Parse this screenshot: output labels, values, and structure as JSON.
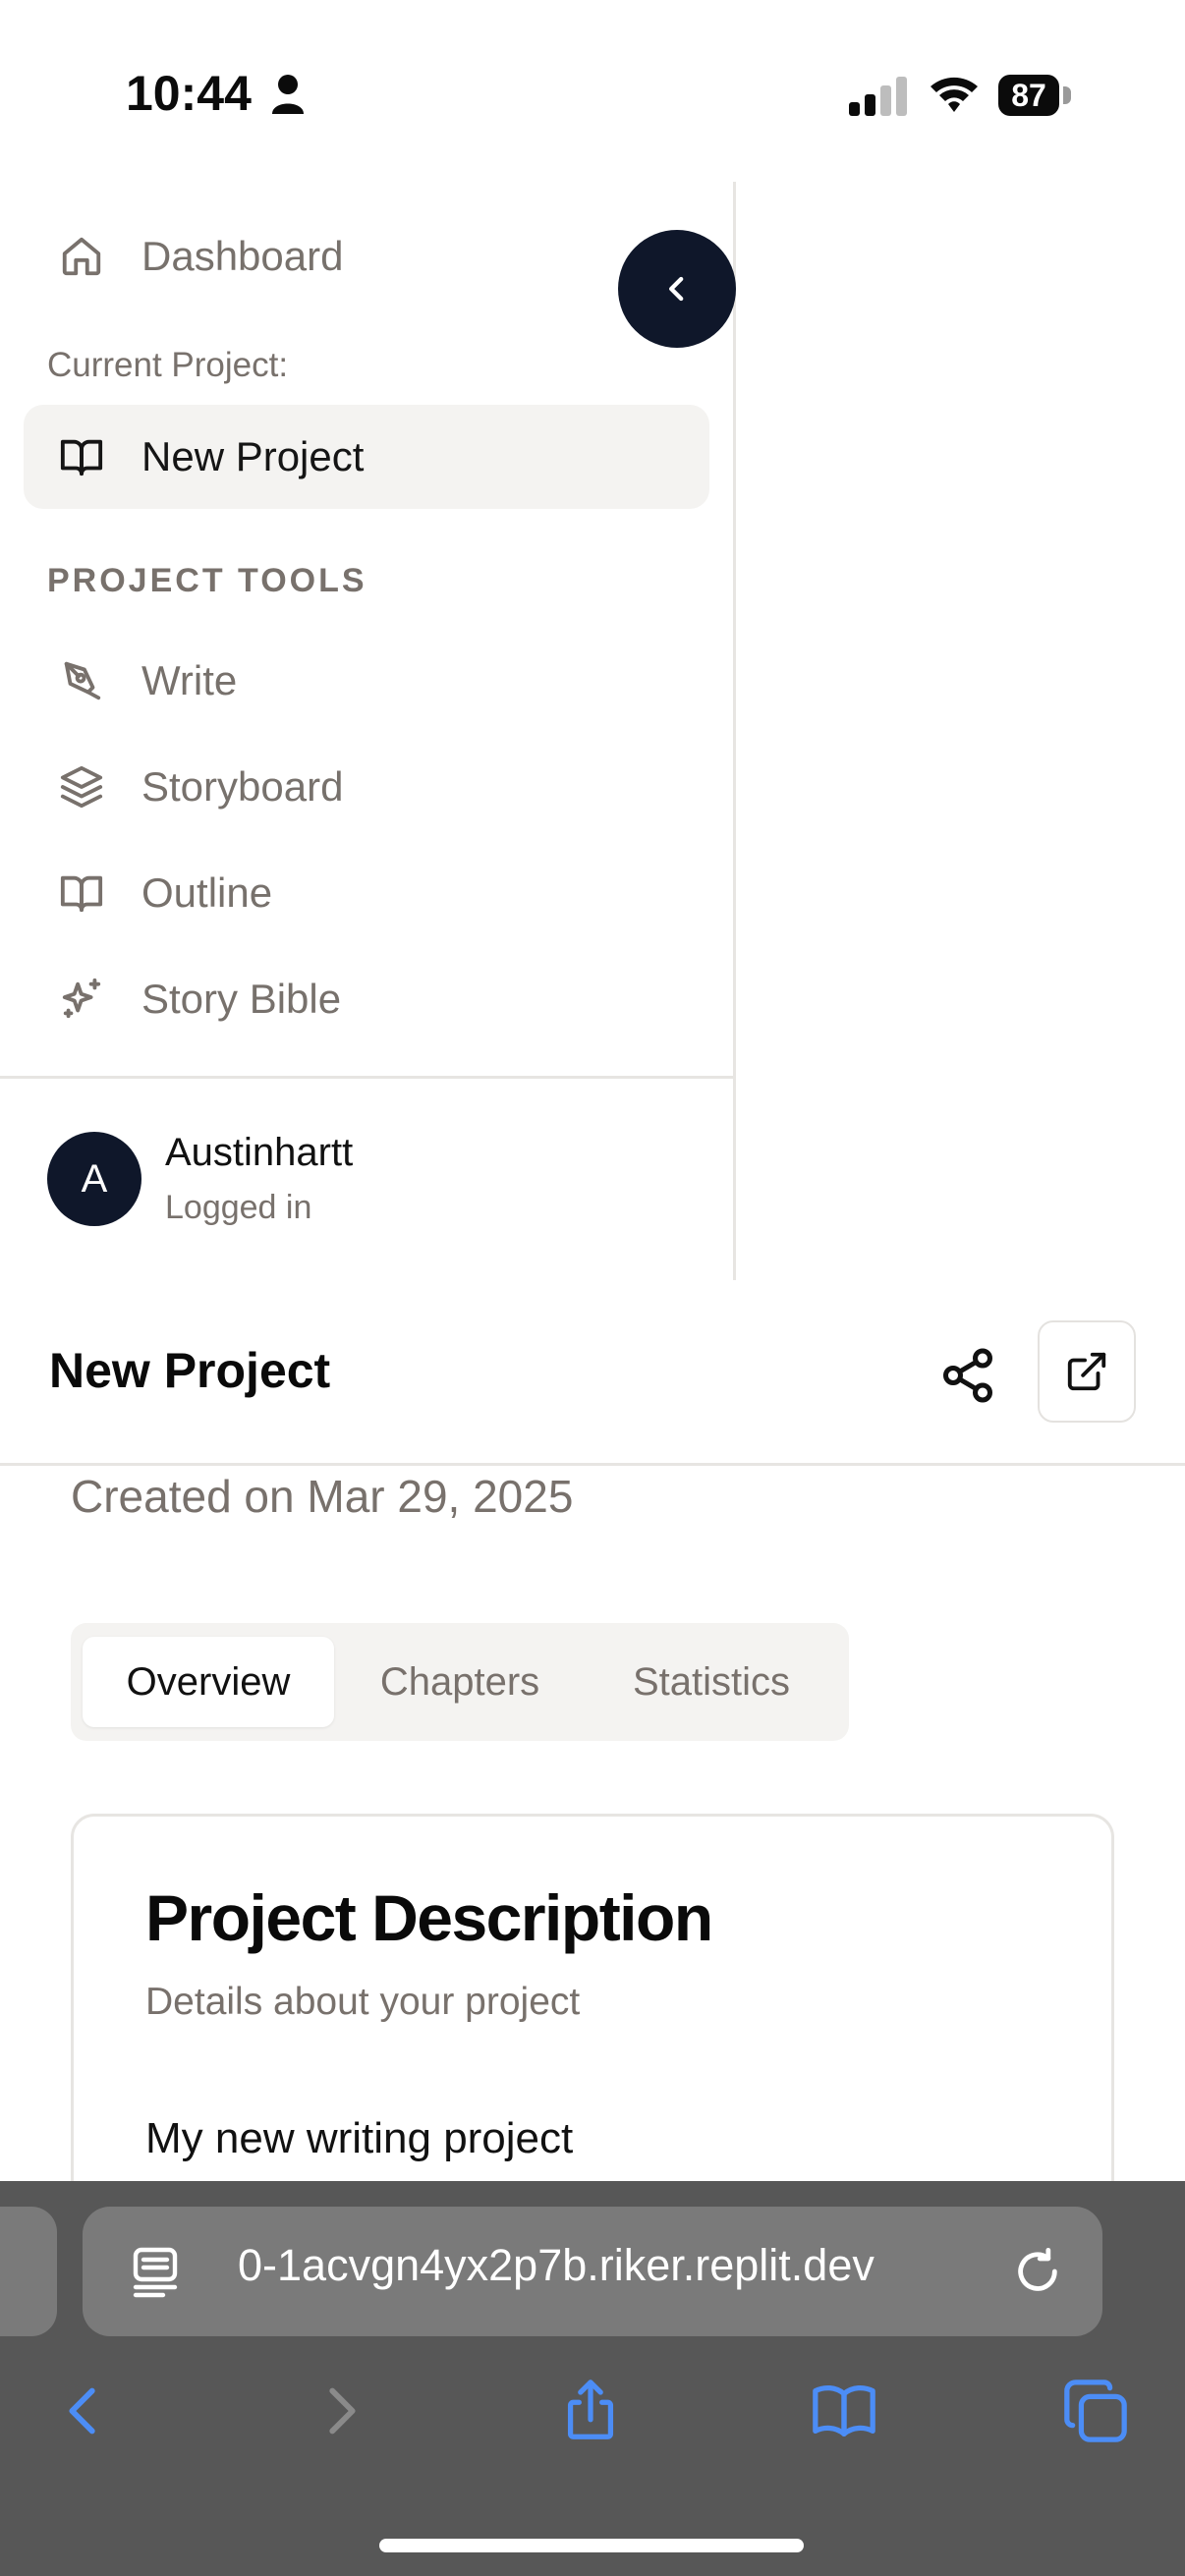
{
  "status_bar": {
    "time": "10:44",
    "battery": "87",
    "icons": [
      "person-icon",
      "signal-icon",
      "wifi-icon",
      "battery-icon"
    ]
  },
  "sidebar": {
    "dashboard_label": "Dashboard",
    "current_project_caption": "Current Project:",
    "current_project": "New Project",
    "tools_heading": "PROJECT TOOLS",
    "tools": [
      {
        "label": "Write",
        "icon": "pen-icon"
      },
      {
        "label": "Storyboard",
        "icon": "layers-icon"
      },
      {
        "label": "Outline",
        "icon": "book-open-icon"
      },
      {
        "label": "Story Bible",
        "icon": "sparkles-icon"
      }
    ],
    "collapse_icon": "chevron-left-icon",
    "user": {
      "initial": "A",
      "name": "Austinhartt",
      "status": "Logged in"
    }
  },
  "header": {
    "title": "New Project",
    "share_icon": "share-icon",
    "open_icon": "external-link-icon"
  },
  "project": {
    "created": "Created on Mar 29, 2025"
  },
  "tabs": [
    {
      "label": "Overview",
      "active": true
    },
    {
      "label": "Chapters",
      "active": false
    },
    {
      "label": "Statistics",
      "active": false
    }
  ],
  "card": {
    "title": "Project Description",
    "subtitle": "Details about your project",
    "body": "My new writing project"
  },
  "browser": {
    "url": "0-1acvgn4yx2p7b.riker.replit.dev",
    "icons": [
      "back-icon",
      "forward-icon",
      "share-icon",
      "bookmarks-icon",
      "tabs-icon"
    ]
  },
  "colors": {
    "accent_dark": "#0f172a",
    "muted_text": "#78716c",
    "active_bg": "#f4f3f1",
    "browser_link": "#4c8df6"
  }
}
